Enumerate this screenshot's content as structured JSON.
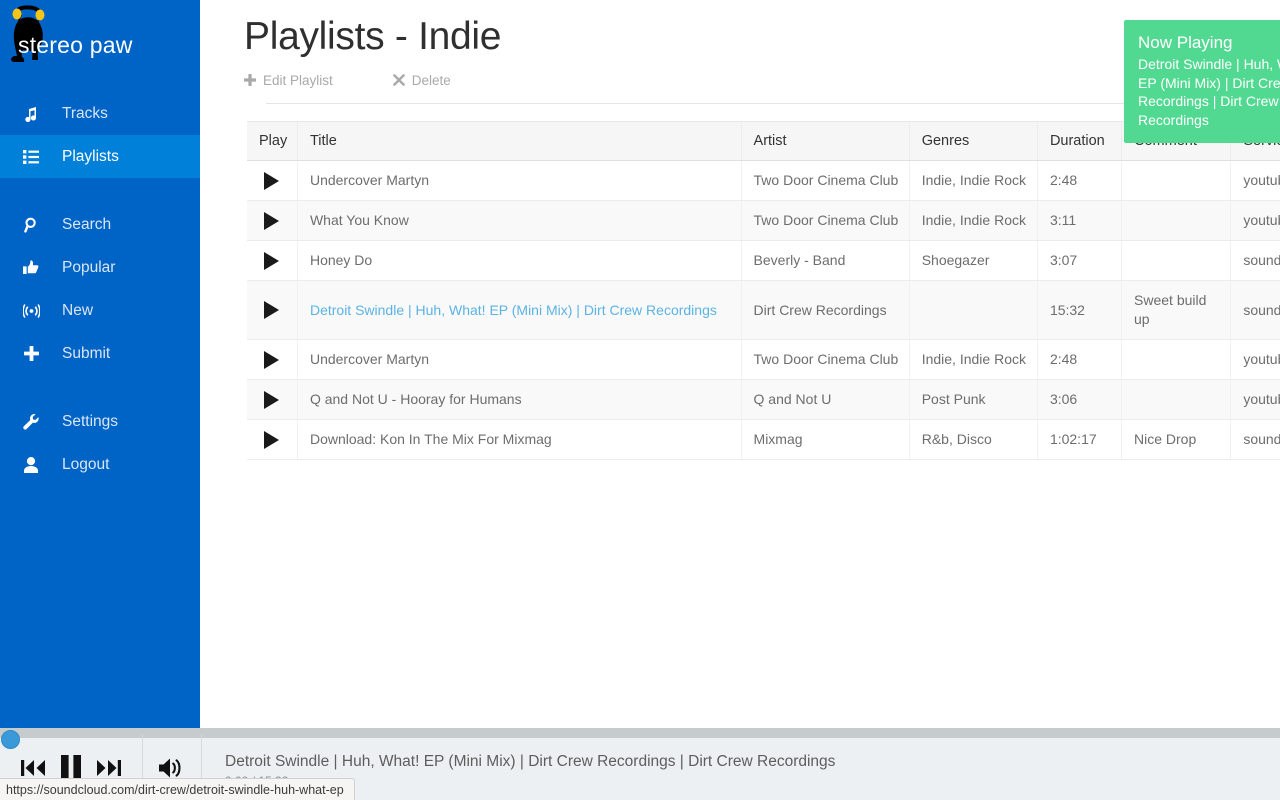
{
  "brand": {
    "name": "stereo paw",
    "logo_icon": "cat-headphones-logo"
  },
  "sidebar": {
    "groups": [
      {
        "items": [
          {
            "label": "Tracks",
            "icon": "music-note-icon",
            "active": false
          },
          {
            "label": "Playlists",
            "icon": "list-icon",
            "active": true
          }
        ]
      },
      {
        "items": [
          {
            "label": "Search",
            "icon": "search-icon",
            "active": false
          },
          {
            "label": "Popular",
            "icon": "thumbs-up-icon",
            "active": false
          },
          {
            "label": "New",
            "icon": "signal-icon",
            "active": false
          },
          {
            "label": "Submit",
            "icon": "plus-icon",
            "active": false
          }
        ]
      },
      {
        "items": [
          {
            "label": "Settings",
            "icon": "wrench-icon",
            "active": false
          },
          {
            "label": "Logout",
            "icon": "user-icon",
            "active": false
          }
        ]
      }
    ]
  },
  "page": {
    "title": "Playlists - Indie",
    "actions": [
      {
        "label": "Edit Playlist",
        "icon": "plus-icon"
      },
      {
        "label": "Delete",
        "icon": "close-x-icon"
      }
    ]
  },
  "toast": {
    "title": "Now Playing",
    "body": "Detroit Swindle | Huh, What! EP (Mini Mix) | Dirt Crew Recordings | Dirt Crew Recordings",
    "color": "#52d991"
  },
  "table": {
    "columns": [
      "Play",
      "Title",
      "Artist",
      "Genres",
      "Duration",
      "Comment",
      "Service"
    ],
    "rows": [
      {
        "title": "Undercover Martyn",
        "artist": "Two Door Cinema Club",
        "genres": "Indie, Indie Rock",
        "duration": "2:48",
        "comment": "",
        "service": "youtube",
        "highlighted": false
      },
      {
        "title": "What You Know",
        "artist": "Two Door Cinema Club",
        "genres": "Indie, Indie Rock",
        "duration": "3:11",
        "comment": "",
        "service": "youtube",
        "highlighted": false
      },
      {
        "title": "Honey Do",
        "artist": "Beverly - Band",
        "genres": "Shoegazer",
        "duration": "3:07",
        "comment": "",
        "service": "soundcloud",
        "highlighted": false
      },
      {
        "title": "Detroit Swindle | Huh, What! EP (Mini Mix) | Dirt Crew Recordings",
        "artist": "Dirt Crew Recordings",
        "genres": "",
        "duration": "15:32",
        "comment": "Sweet build up",
        "service": "soundcloud",
        "highlighted": true
      },
      {
        "title": "Undercover Martyn",
        "artist": "Two Door Cinema Club",
        "genres": "Indie, Indie Rock",
        "duration": "2:48",
        "comment": "",
        "service": "youtube",
        "highlighted": false
      },
      {
        "title": "Q and Not U - Hooray for Humans",
        "artist": "Q and Not U",
        "genres": "Post Punk",
        "duration": "3:06",
        "comment": "",
        "service": "youtube",
        "highlighted": false
      },
      {
        "title": "Download: Kon In The Mix For Mixmag",
        "artist": "Mixmag",
        "genres": "R&b, Disco",
        "duration": "1:02:17",
        "comment": "Nice Drop",
        "service": "soundcloud",
        "highlighted": false
      }
    ]
  },
  "player": {
    "track": "Detroit Swindle | Huh, What! EP (Mini Mix) | Dirt Crew Recordings | Dirt Crew Recordings",
    "time": "0:00 / 15:32",
    "progress_percent": 0,
    "controls": [
      {
        "name": "previous-button",
        "icon": "previous-icon"
      },
      {
        "name": "pause-button",
        "icon": "pause-icon"
      },
      {
        "name": "next-button",
        "icon": "next-icon"
      }
    ],
    "volume_icon": "volume-icon"
  },
  "statusbar": {
    "url": "https://soundcloud.com/dirt-crew/detroit-swindle-huh-what-ep"
  }
}
